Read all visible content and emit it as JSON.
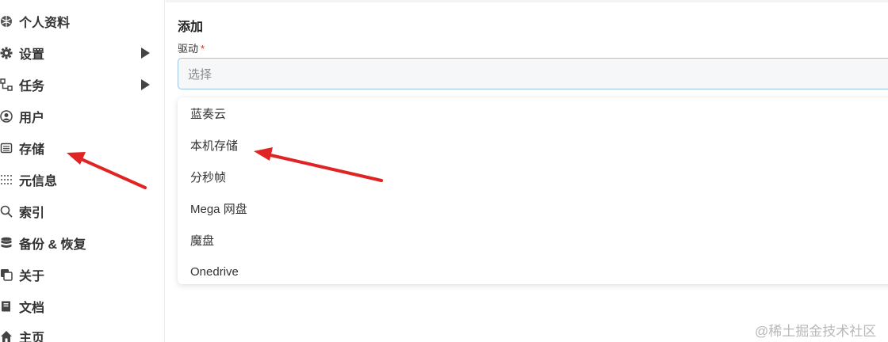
{
  "sidebar": {
    "items": [
      {
        "label": "个人资料",
        "icon": "profile-icon"
      },
      {
        "label": "设置",
        "icon": "gear-icon",
        "has_children": true
      },
      {
        "label": "任务",
        "icon": "tasks-icon",
        "has_children": true
      },
      {
        "label": "用户",
        "icon": "user-icon"
      },
      {
        "label": "存储",
        "icon": "storage-icon"
      },
      {
        "label": "元信息",
        "icon": "meta-icon"
      },
      {
        "label": "索引",
        "icon": "search-icon"
      },
      {
        "label": "备份 & 恢复",
        "icon": "database-icon"
      },
      {
        "label": "关于",
        "icon": "copy-icon"
      },
      {
        "label": "文档",
        "icon": "book-icon"
      },
      {
        "label": "主页",
        "icon": "home-icon"
      }
    ]
  },
  "form": {
    "title": "添加",
    "driver_label": "驱动",
    "required_mark": "*",
    "select_placeholder": "选择",
    "options": [
      "蓝奏云",
      "本机存储",
      "分秒帧",
      "Mega 网盘",
      "魔盘",
      "Onedrive"
    ]
  },
  "watermark": "@稀土掘金技术社区",
  "colors": {
    "arrow": "#e02424",
    "select_border": "#9bc4e6",
    "required": "#e02424"
  }
}
